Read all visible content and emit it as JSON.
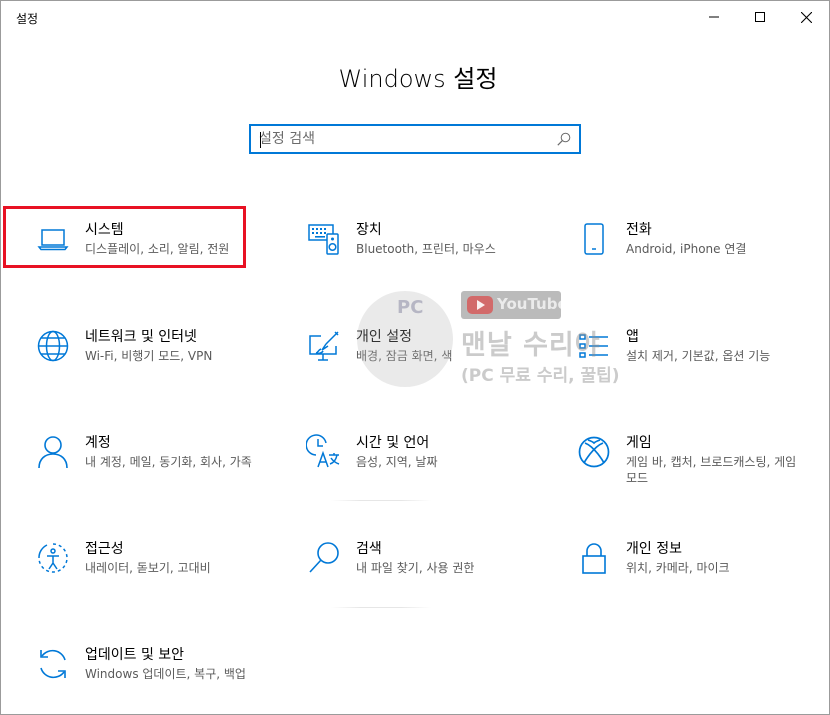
{
  "window": {
    "app_title": "설정",
    "controls": {
      "minimize": "minimize-icon",
      "maximize": "maximize-icon",
      "close": "close-icon"
    }
  },
  "header": {
    "title": "Windows 설정"
  },
  "search": {
    "placeholder": "설정 검색",
    "icon": "search-icon"
  },
  "tiles": [
    {
      "name": "시스템",
      "desc": "디스플레이, 소리, 알림, 전원",
      "icon": "laptop-icon"
    },
    {
      "name": "장치",
      "desc": "Bluetooth, 프린터, 마우스",
      "icon": "devices-icon"
    },
    {
      "name": "전화",
      "desc": "Android, iPhone 연결",
      "icon": "phone-icon"
    },
    {
      "name": "네트워크 및 인터넷",
      "desc": "Wi-Fi, 비행기 모드, VPN",
      "icon": "globe-icon"
    },
    {
      "name": "개인 설정",
      "desc": "배경, 잠금 화면, 색",
      "icon": "personalization-icon"
    },
    {
      "name": "앱",
      "desc": "설치 제거, 기본값, 옵션 기능",
      "icon": "apps-icon"
    },
    {
      "name": "계정",
      "desc": "내 계정, 메일, 동기화, 회사, 가족",
      "icon": "person-icon"
    },
    {
      "name": "시간 및 언어",
      "desc": "음성, 지역, 날짜",
      "icon": "time-language-icon"
    },
    {
      "name": "게임",
      "desc": "게임 바, 캡처, 브로드캐스팅, 게임 모드",
      "icon": "xbox-icon"
    },
    {
      "name": "접근성",
      "desc": "내레이터, 돋보기, 고대비",
      "icon": "ease-of-access-icon"
    },
    {
      "name": "검색",
      "desc": "내 파일 찾기, 사용 권한",
      "icon": "search-icon"
    },
    {
      "name": "개인 정보",
      "desc": "위치, 카메라, 마이크",
      "icon": "lock-icon"
    },
    {
      "name": "업데이트 및 보안",
      "desc": "Windows 업데이트, 복구, 백업",
      "icon": "sync-icon"
    }
  ],
  "watermark": {
    "badge": "PC",
    "youtube": "YouTube",
    "line1": "맨날 수리야",
    "line2": "(PC 무료 수리, 꿀팁)"
  },
  "colors": {
    "accent": "#0078d7",
    "highlight": "#e81123"
  }
}
